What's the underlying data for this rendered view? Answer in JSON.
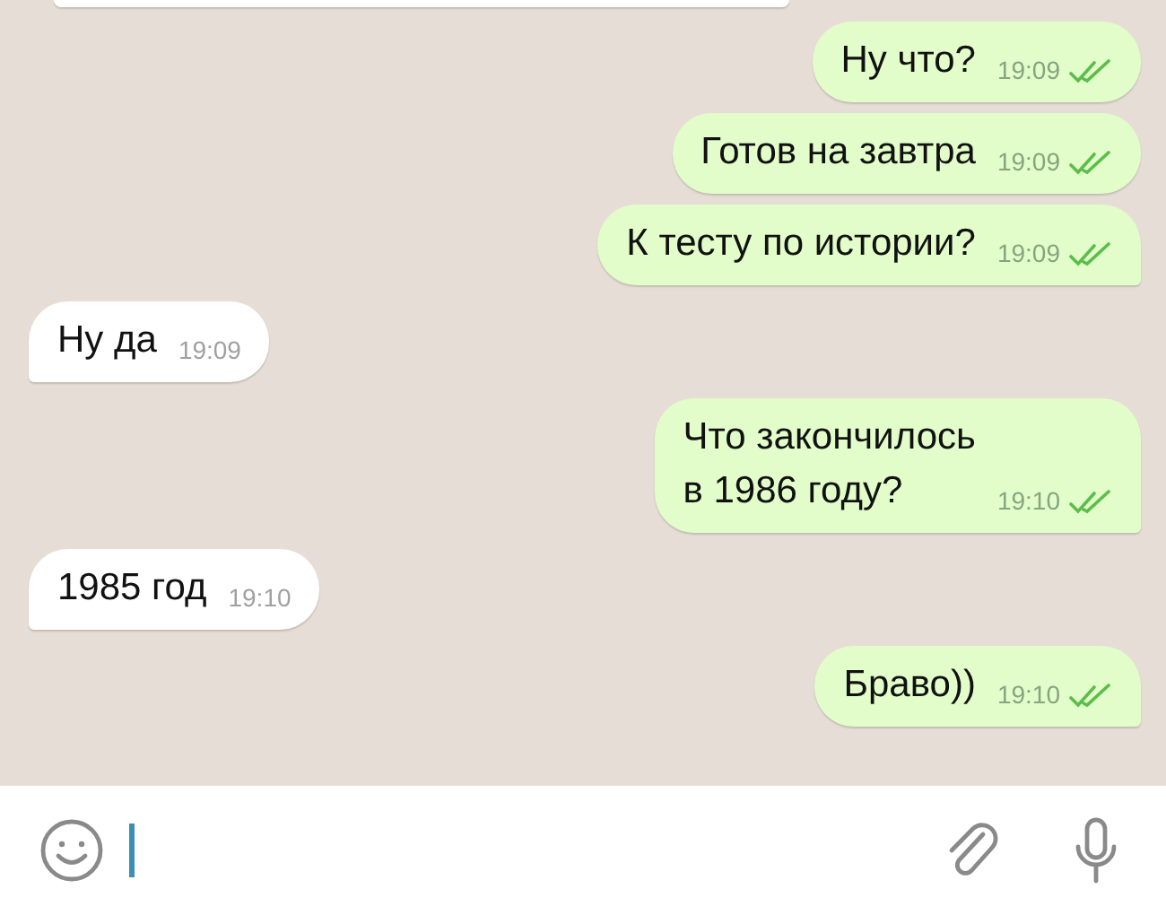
{
  "messages": [
    {
      "kind": "in_cut"
    },
    {
      "kind": "out",
      "text": "Ну что?",
      "time": "19:09",
      "tail": false
    },
    {
      "kind": "out",
      "text": "Готов на завтра",
      "time": "19:09",
      "tail": false
    },
    {
      "kind": "out",
      "text": "К тесту по истории?",
      "time": "19:09",
      "tail": true
    },
    {
      "kind": "in",
      "text": "Ну да",
      "time": "19:09",
      "tail": true
    },
    {
      "kind": "out",
      "text": "Что закончилось\nв 1986 году?",
      "time": "19:10",
      "tail": true
    },
    {
      "kind": "in",
      "text": "1985 год",
      "time": "19:10",
      "tail": true
    },
    {
      "kind": "out",
      "text": "Браво))",
      "time": "19:10",
      "tail": true
    }
  ]
}
